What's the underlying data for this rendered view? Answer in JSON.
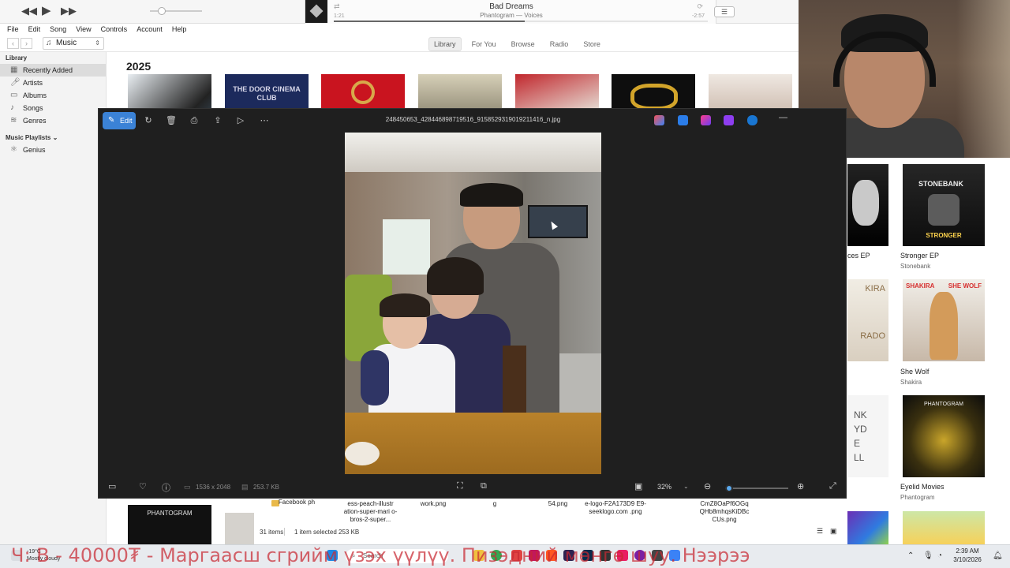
{
  "itunes": {
    "player": {
      "prev_icon": "rewind-icon",
      "play_icon": "play-icon",
      "next_icon": "fast-forward-icon",
      "now_playing_title": "Bad Dreams",
      "now_playing_sub": "Phantogram — Voices",
      "elapsed": "1:21",
      "remaining": "-2:57",
      "progress_fraction": 0.51
    },
    "menu": [
      "File",
      "Edit",
      "Song",
      "View",
      "Controls",
      "Account",
      "Help"
    ],
    "media_kind": "Music",
    "tabs": [
      "Library",
      "For You",
      "Browse",
      "Radio",
      "Store"
    ],
    "active_tab": "Library",
    "sidebar": {
      "library_header": "Library",
      "library_items": [
        {
          "label": "Recently Added",
          "icon": "grid-icon"
        },
        {
          "label": "Artists",
          "icon": "microphone-icon"
        },
        {
          "label": "Albums",
          "icon": "album-icon"
        },
        {
          "label": "Songs",
          "icon": "note-icon"
        },
        {
          "label": "Genres",
          "icon": "genres-icon"
        }
      ],
      "playlists_header": "Music Playlists",
      "playlist_items": [
        {
          "label": "Genius",
          "icon": "atom-icon"
        }
      ]
    },
    "content": {
      "year": "2025",
      "albums_right": [
        {
          "title": "ces EP",
          "artist": ""
        },
        {
          "title": "Stronger EP",
          "artist": "Stonebank"
        },
        {
          "title": "",
          "artist": ""
        },
        {
          "title": "She Wolf",
          "artist": "Shakira"
        },
        {
          "title": "",
          "artist": ""
        },
        {
          "title": "Eyelid Movies",
          "artist": "Phantogram"
        }
      ],
      "cover_text": {
        "stonebank": "STONEBANK",
        "stronger": "STRONGER",
        "shakira": "SHAKIRA",
        "she_wolf": "SHE WOLF",
        "phantogram": "PHANTOGRAM",
        "door": "THE DOOR CINEMA CLUB"
      }
    }
  },
  "viewer": {
    "edit_label": "Edit",
    "filename": "248450653_428446898719516_9158529319019211416_n.jpg",
    "dimensions": "1536 x 2048",
    "file_size": "253.7 KB",
    "zoom": "32%",
    "zoom_fraction": 0.05,
    "toolbar_icons": [
      "rotate-icon",
      "delete-icon",
      "print-icon",
      "share-icon",
      "slideshow-icon",
      "more-icon"
    ],
    "bottom_icons": [
      "filmstrip-icon",
      "favorite-icon",
      "info-icon",
      "fit-icon",
      "compare-icon",
      "zoom-out-icon",
      "zoom-in-icon",
      "fullscreen-icon"
    ]
  },
  "explorer": {
    "files": [
      "Facebook ph",
      "ess-peach-illustr ation-super-mari o-bros-2-super...",
      "work.png",
      "g",
      "54.png",
      "e-logo-F2A173D9 E9-seeklogo.com .png",
      "CmZ8OaPf6OGq QHb8mhqsKiDBc CUs.png"
    ],
    "items_count": "31 items",
    "selection": "1 item selected  253 KB"
  },
  "taskbar": {
    "ticker": "Ч: В - 40000₮ - Маргаасш сгрийм үзэх үүлүү. Пизэдний мөнгө шуу. Нээрээ",
    "weather_temp": "-19°C",
    "weather_text": "Mostly cloudy",
    "search_label": "Search",
    "time": "2:39 AM",
    "date": "3/10/2026"
  }
}
